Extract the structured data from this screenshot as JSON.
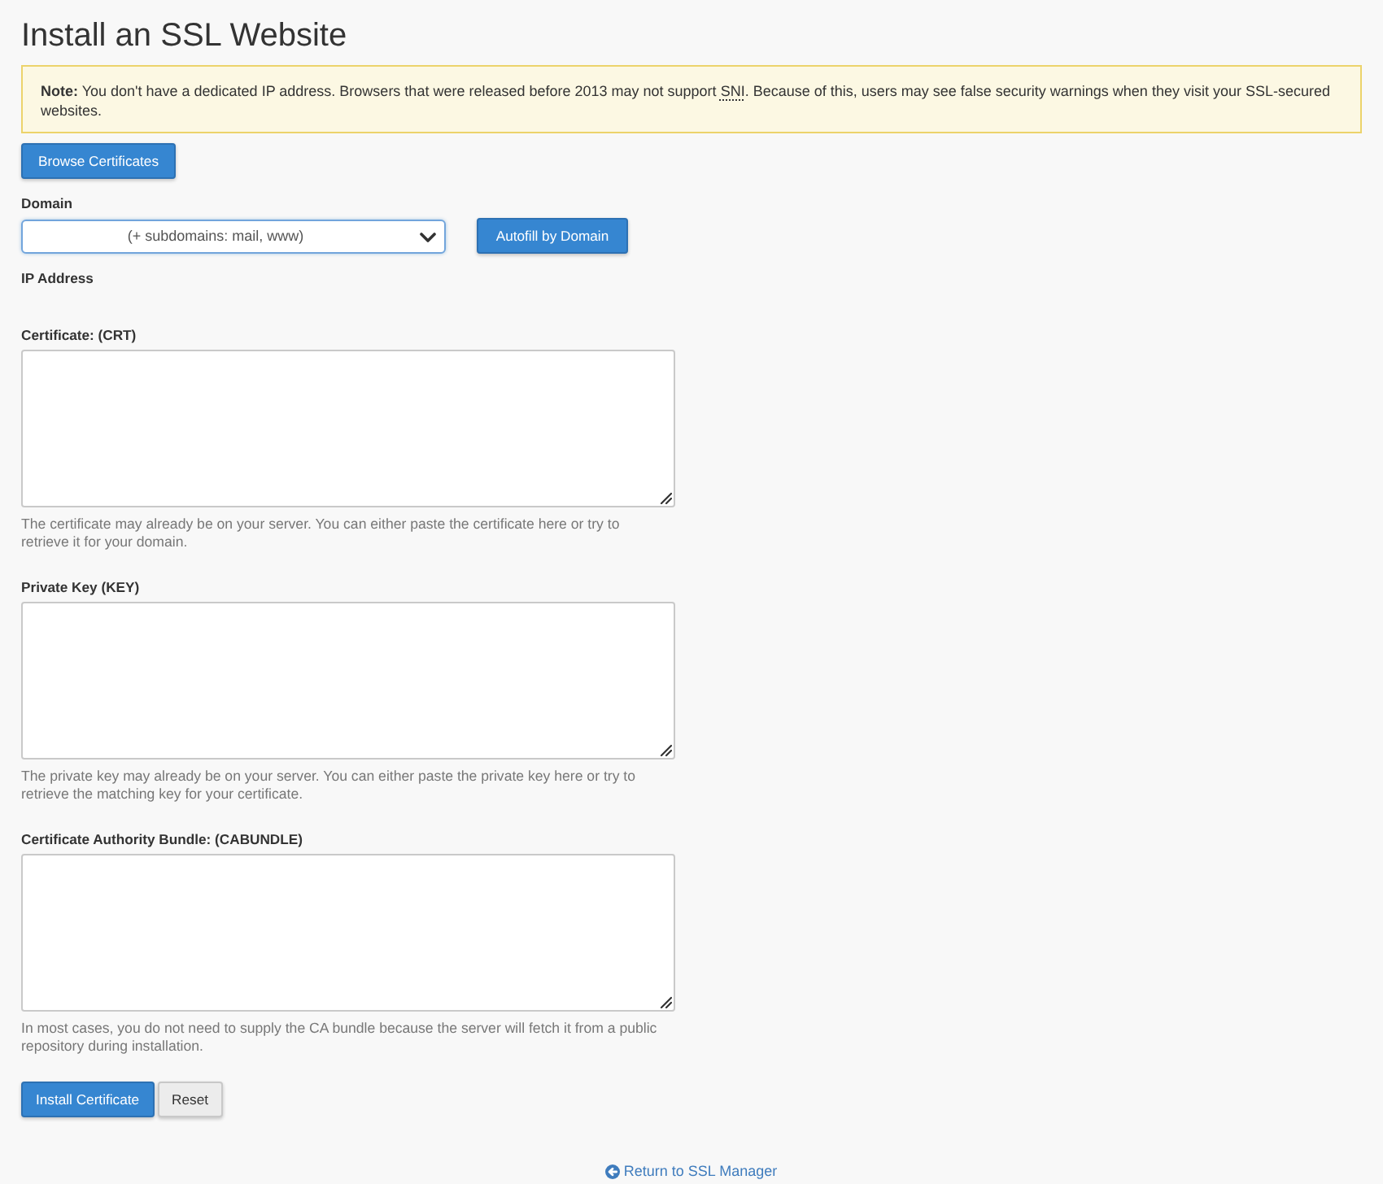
{
  "page": {
    "title": "Install an SSL Website"
  },
  "notice": {
    "segments": [
      {
        "kind": "bold",
        "text": "Note:"
      },
      {
        "kind": "plain",
        "text": " You don't have a dedicated IP address. Browsers that were released before 2013 may not support "
      },
      {
        "kind": "abbr",
        "text": "SNI"
      },
      {
        "kind": "plain",
        "text": ". Because of this, users may see false security warnings when they visit your SSL-secured websites."
      }
    ]
  },
  "browse_button": {
    "label": "Browse Certificates"
  },
  "domain": {
    "label": "Domain",
    "value": "(+ subdomains: mail, www)",
    "focused": true,
    "button": "Autofill by Domain"
  },
  "ip_address": {
    "label": "IP Address"
  },
  "fields": [
    {
      "label": "Certificate: (CRT)",
      "help": "The certificate may already be on your server. You can either paste the certificate here or try to retrieve it for your domain."
    },
    {
      "label": "Private Key (KEY)",
      "help": "The private key may already be on your server. You can either paste the private key here or try to retrieve the matching key for your certificate."
    },
    {
      "label": "Certificate Authority Bundle: (CABUNDLE)",
      "help": "In most cases, you do not need to supply the CA bundle because the server will fetch it from a public repository during installation."
    }
  ],
  "actions": [
    {
      "kind": "primary",
      "label": "Install Certificate"
    },
    {
      "kind": "default",
      "label": "Reset"
    }
  ],
  "footer_link": {
    "label": "Return to SSL Manager"
  }
}
